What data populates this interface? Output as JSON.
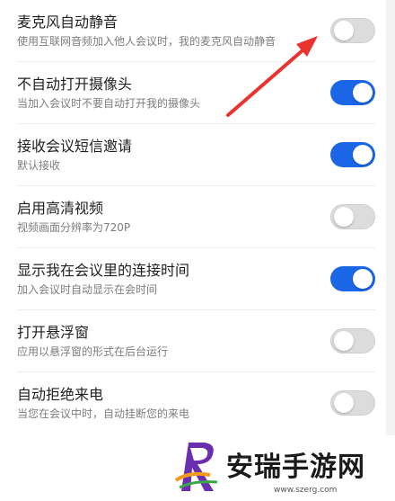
{
  "settings": [
    {
      "title": "麦克风自动静音",
      "subtitle": "使用互联网音频加入他人会议时，我的麦克风自动静音",
      "enabled": false
    },
    {
      "title": "不自动打开摄像头",
      "subtitle": "当加入会议时不要自动打开我的摄像头",
      "enabled": true
    },
    {
      "title": "接收会议短信邀请",
      "subtitle": "默认接收",
      "enabled": true
    },
    {
      "title": "启用高清视频",
      "subtitle": "视频画面分辨率为720P",
      "enabled": false
    },
    {
      "title": "显示我在会议里的连接时间",
      "subtitle": "加入会议时自动显示在会时间",
      "enabled": true
    },
    {
      "title": "打开悬浮窗",
      "subtitle": "应用以悬浮窗的形式在后台运行",
      "enabled": false
    },
    {
      "title": "自动拒绝来电",
      "subtitle": "当您在会议中时，自动挂断您的来电",
      "enabled": false
    }
  ],
  "watermark": {
    "name": "安瑞手游网",
    "url": "www.szerg.com"
  },
  "colors": {
    "toggle_on": "#1a66e6",
    "toggle_off": "#dcdcdc",
    "arrow": "#e8332f"
  },
  "annotation": {
    "type": "arrow",
    "points_to": "麦克风自动静音 toggle"
  }
}
